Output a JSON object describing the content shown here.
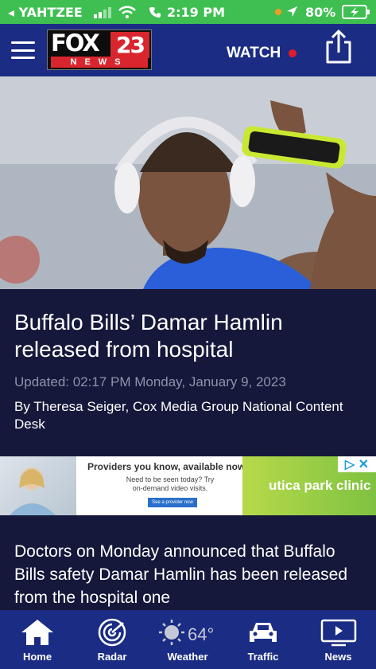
{
  "status_bar": {
    "back_app": "◂ YAHTZEE",
    "time": "2:19 PM",
    "battery": "80%"
  },
  "header": {
    "logo_text": "FOX",
    "logo_number": "23",
    "logo_sub": "NEWS",
    "watch_label": "WATCH"
  },
  "article": {
    "headline": "Buffalo Bills’ Damar Hamlin released from hospital",
    "updated": "Updated: 02:17 PM Monday, January 9, 2023",
    "byline": "By Theresa Seiger, Cox Media Group National Content Desk",
    "body": "Doctors on Monday announced that Buffalo Bills safety Damar Hamlin has been released from the hospital one"
  },
  "ad": {
    "title": "Providers you know, available now.",
    "sub": "Need to be seen today? Try on-demand video visits.",
    "button": "See a provider now",
    "brand": "utica park clinic"
  },
  "tabs": [
    {
      "label": "Home",
      "icon": "home-icon"
    },
    {
      "label": "Radar",
      "icon": "radar-icon"
    },
    {
      "label": "Weather",
      "icon": "sun-icon"
    },
    {
      "label": "Traffic",
      "icon": "car-icon"
    },
    {
      "label": "News",
      "icon": "tv-icon"
    }
  ],
  "weather": {
    "temperature": "64°"
  },
  "colors": {
    "header_bg": "#1b2c85",
    "page_bg": "#15183a",
    "status_green": "#3fbf52",
    "accent_red": "#d9262e"
  }
}
